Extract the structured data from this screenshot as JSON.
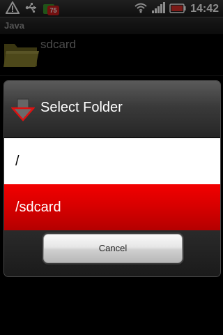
{
  "status_bar": {
    "time": "14:42",
    "notification_count": "75",
    "icons": [
      "warning-icon",
      "usb-icon",
      "notification-badge",
      "wifi-icon",
      "signal-icon",
      "battery-icon"
    ]
  },
  "app": {
    "title": "Java",
    "file_label": "sdcard"
  },
  "dialog": {
    "title": "Select Folder",
    "icon": "folder-down-arrow-icon",
    "items": [
      {
        "label": "/"
      },
      {
        "label": "/sdcard"
      }
    ],
    "selected_index": 1,
    "cancel_label": "Cancel"
  },
  "colors": {
    "selection_red": "#e00000",
    "list_white": "#ffffff",
    "header_gray": "#3a3a3a"
  }
}
